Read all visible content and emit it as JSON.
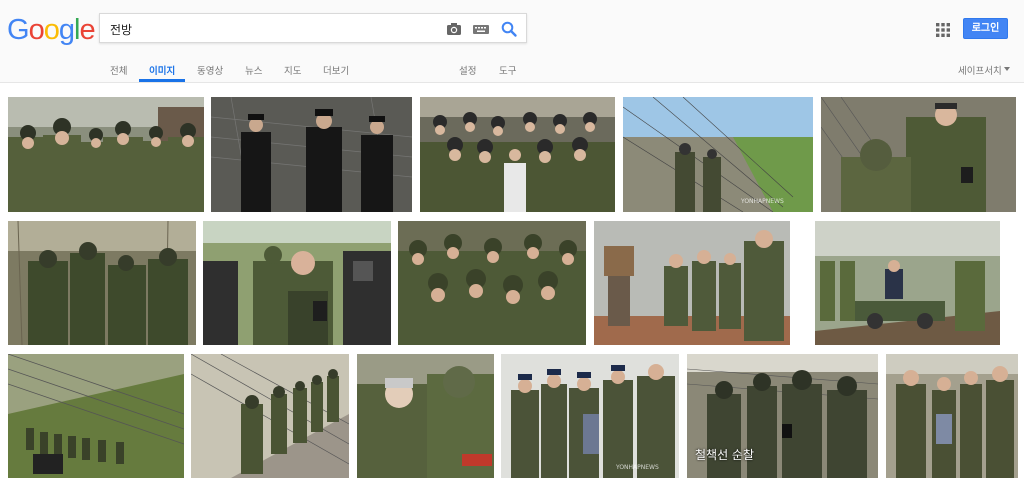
{
  "logo": {
    "text": "Google",
    "letters": [
      "G",
      "o",
      "o",
      "g",
      "l",
      "e"
    ],
    "colors": [
      "#4285f4",
      "#ea4335",
      "#fbbc05",
      "#4285f4",
      "#34a853",
      "#ea4335"
    ]
  },
  "search": {
    "value": "전방",
    "placeholder": ""
  },
  "header": {
    "login_label": "로그인",
    "accent": "#4285f4"
  },
  "tabs": {
    "all": "전체",
    "images": "이미지",
    "videos": "동영상",
    "news": "뉴스",
    "maps": "지도",
    "more": "더보기",
    "settings": "설정",
    "tools": "도구",
    "safesearch": "세이프서치"
  },
  "icons": [
    "camera-icon",
    "keyboard-icon",
    "search-icon",
    "apps-icon",
    "chevron-down-icon"
  ],
  "images": {
    "watermarks": {
      "yonhap": "YONHAPNEWS"
    },
    "caption_row3_5": "철책선 순찰"
  }
}
